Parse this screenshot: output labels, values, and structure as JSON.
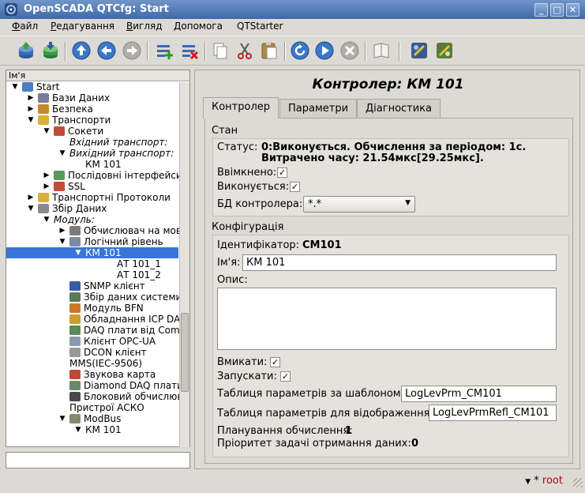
{
  "window": {
    "title": "OpenSCADA QTCfg: Start"
  },
  "menu": [
    {
      "label": "Файл",
      "u": "Ф",
      "rest": "айл"
    },
    {
      "label": "Редагування",
      "u": "Р",
      "rest": "едагування"
    },
    {
      "label": "Вигляд",
      "u": "В",
      "rest": "игляд"
    },
    {
      "label": "Допомога",
      "u": "Д",
      "rest": "опомога"
    },
    {
      "label": "QTStarter",
      "u": "",
      "rest": "QTStarter"
    }
  ],
  "toolbar_icons": [
    "db-load-icon",
    "db-save-icon",
    "up-icon",
    "back-icon",
    "forward-icon",
    "add-item-icon",
    "delete-item-icon",
    "copy-icon",
    "cut-icon",
    "paste-icon",
    "refresh-icon",
    "start-icon",
    "stop-icon",
    "manual-icon",
    "qtcfg-icon",
    "vision-icon"
  ],
  "tree": {
    "header": "Ім'я",
    "rows": [
      {
        "label": "Start",
        "indent": 0,
        "arrow": "down",
        "icon": "#4a7ec2"
      },
      {
        "label": "Бази Даних",
        "indent": 1,
        "arrow": "right",
        "icon": "#7a7a9a"
      },
      {
        "label": "Безпека",
        "indent": 1,
        "arrow": "right",
        "icon": "#c58a2a"
      },
      {
        "label": "Транспорти",
        "indent": 1,
        "arrow": "down",
        "icon": "#d8b13a"
      },
      {
        "label": "Сокети",
        "indent": 2,
        "arrow": "down",
        "icon": "#c44a3a"
      },
      {
        "label": "Вхідний транспорт:",
        "indent": 3,
        "arrow": "",
        "italic": true
      },
      {
        "label": "Вихідний транспорт:",
        "indent": 3,
        "arrow": "down",
        "italic": true
      },
      {
        "label": "КМ 101",
        "indent": 4,
        "arrow": ""
      },
      {
        "label": "Послідовні інтерфейси",
        "indent": 2,
        "arrow": "right",
        "icon": "#5a9a5a"
      },
      {
        "label": "SSL",
        "indent": 2,
        "arrow": "right",
        "icon": "#c44a3a"
      },
      {
        "label": "Транспортні Протоколи",
        "indent": 1,
        "arrow": "right",
        "icon": "#d8b13a"
      },
      {
        "label": "Збір Даних",
        "indent": 1,
        "arrow": "down",
        "icon": "#8a8a8a"
      },
      {
        "label": "Модуль:",
        "indent": 2,
        "arrow": "down",
        "italic": true
      },
      {
        "label": "Обчислювач на мові",
        "indent": 3,
        "arrow": "right",
        "icon": "#7a7a7a"
      },
      {
        "label": "Логічний рівень",
        "indent": 3,
        "arrow": "down",
        "icon": "#7a8aa0"
      },
      {
        "label": "КМ 101",
        "indent": 4,
        "arrow": "down",
        "selected": true
      },
      {
        "label": "АТ 101_1",
        "indent": 6,
        "arrow": ""
      },
      {
        "label": "АТ 101_2",
        "indent": 6,
        "arrow": ""
      },
      {
        "label": "SNMP клієнт",
        "indent": 3,
        "arrow": "",
        "icon": "#3a5aa8"
      },
      {
        "label": "Збір даних системи",
        "indent": 3,
        "arrow": "",
        "icon": "#5a7a5a"
      },
      {
        "label": "Модуль BFN",
        "indent": 3,
        "arrow": "",
        "icon": "#c87a2a"
      },
      {
        "label": "Обладнання ICP DAS",
        "indent": 3,
        "arrow": "",
        "icon": "#c8a030"
      },
      {
        "label": "DAQ плати від Comedi",
        "indent": 3,
        "arrow": "",
        "icon": "#5a8a5a"
      },
      {
        "label": "Клієнт OPC-UA",
        "indent": 3,
        "arrow": "",
        "icon": "#8a9ab0"
      },
      {
        "label": "DCON клієнт",
        "indent": 3,
        "arrow": "",
        "icon": "#9a9a9a"
      },
      {
        "label": "MMS(IEC-9506)",
        "indent": 3,
        "arrow": "",
        "noicon": true
      },
      {
        "label": "Звукова карта",
        "indent": 3,
        "arrow": "",
        "icon": "#c04a3a"
      },
      {
        "label": "Diamond DAQ плати",
        "indent": 3,
        "arrow": "",
        "icon": "#6a8a6a"
      },
      {
        "label": "Блоковий обчислювач",
        "indent": 3,
        "arrow": "",
        "icon": "#4a4a4a"
      },
      {
        "label": "Пристрої АСКО",
        "indent": 3,
        "arrow": "",
        "noicon": true
      },
      {
        "label": "ModBus",
        "indent": 3,
        "arrow": "down",
        "icon": "#8a8a6a"
      },
      {
        "label": "КМ 101",
        "indent": 4,
        "arrow": "down"
      }
    ]
  },
  "content": {
    "title": "Контролер: КМ 101",
    "tabs": [
      "Контролер",
      "Параметри",
      "Діагностика"
    ],
    "state": {
      "group_title": "Стан",
      "status_label": "Статус:",
      "status_line1": "0:Виконується. Обчислення за періодом: 1с.",
      "status_line2": "Витрачено часу: 21.54мкс[29.25мкс].",
      "enabled_label": "Ввімкнено:",
      "running_label": "Виконується:",
      "db_label": "БД контролера:",
      "db_value": "*.*"
    },
    "config": {
      "group_title": "Конфігурація",
      "id_label": "Ідентифікатор:",
      "id_value": "CM101",
      "name_label": "Ім'я:",
      "name_value": "КМ 101",
      "descr_label": "Опис:",
      "descr_value": "",
      "to_enable_label": "Вмикати:",
      "to_start_label": "Запускати:",
      "prm_table_label": "Таблиця параметрів за шаблоном:",
      "prm_table_value": "LogLevPrm_CM101",
      "prm_refl_label": "Таблиця параметрів для відображення:",
      "prm_refl_value": "LogLevPrmRefl_CM101",
      "sched_label": "Планування обчислення:",
      "sched_value": "1",
      "prior_label": "Пріоритет задачі отримання даних:",
      "prior_value": "0"
    }
  },
  "statusbar": {
    "mark": "*",
    "user": "root"
  }
}
